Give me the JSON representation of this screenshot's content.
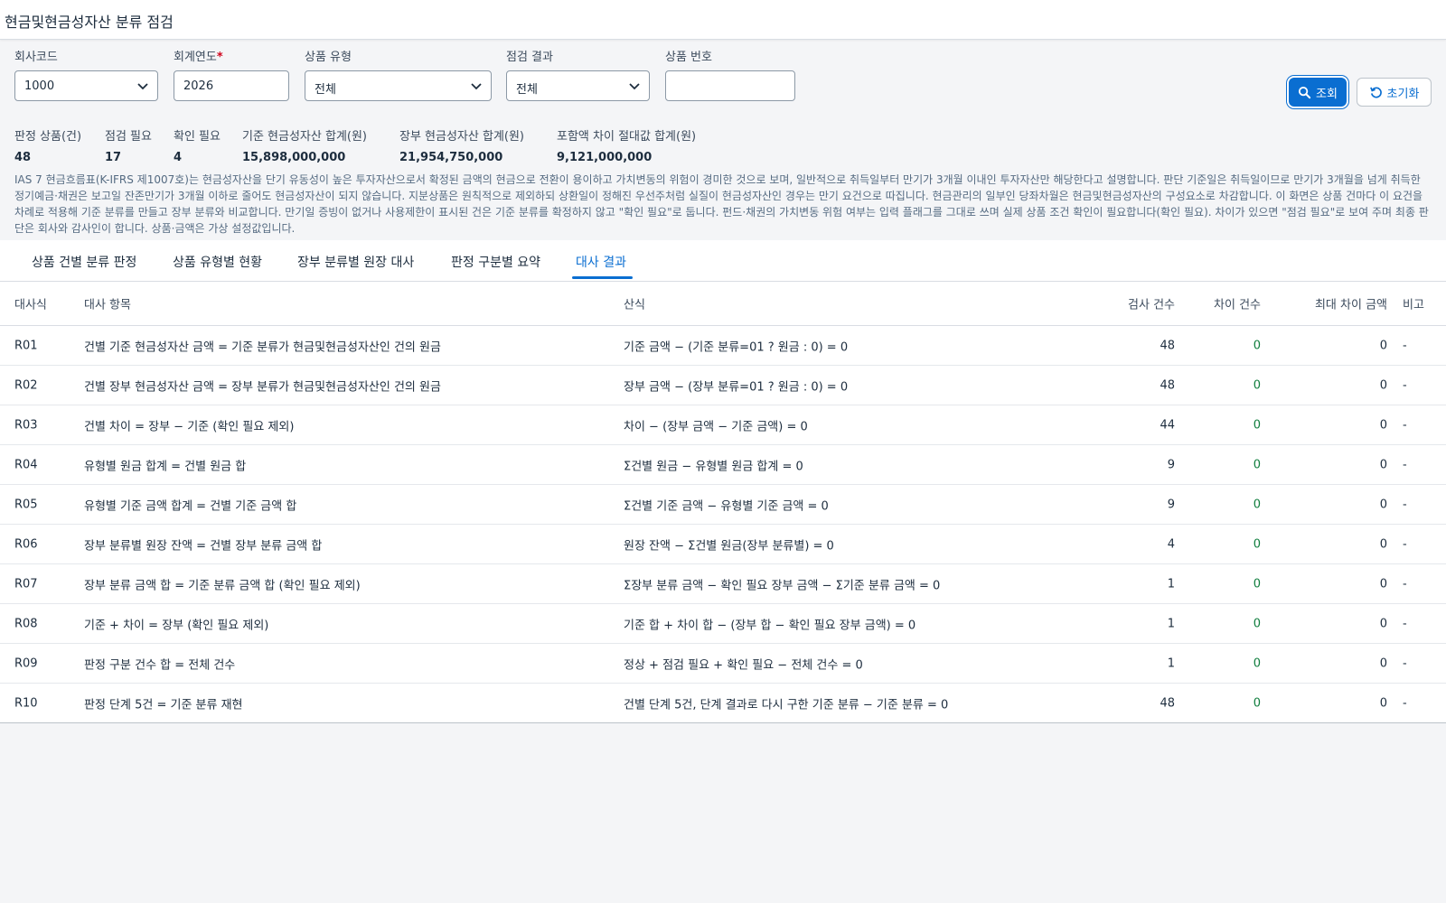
{
  "page_title": "현금및현금성자산 분류 점검",
  "filters": {
    "company_code": {
      "label": "회사코드",
      "value": "1000"
    },
    "fiscal_year": {
      "label": "회계연도",
      "required_mark": "*",
      "value": "2026"
    },
    "product_type": {
      "label": "상품 유형",
      "value": "전체"
    },
    "check_result": {
      "label": "점검 결과",
      "value": "전체"
    },
    "product_number": {
      "label": "상품 번호",
      "value": ""
    }
  },
  "buttons": {
    "search": "조회",
    "reset": "초기화"
  },
  "kpis": [
    {
      "label": "판정 상품(건)",
      "value": "48"
    },
    {
      "label": "점검 필요",
      "value": "17"
    },
    {
      "label": "확인 필요",
      "value": "4"
    },
    {
      "label": "기준 현금성자산 합계(원)",
      "value": "15,898,000,000"
    },
    {
      "label": "장부 현금성자산 합계(원)",
      "value": "21,954,750,000"
    },
    {
      "label": "포함액 차이 절대값 합계(원)",
      "value": "9,121,000,000"
    }
  ],
  "notice": "IAS 7 현금흐름표(K-IFRS 제1007호)는 현금성자산을 단기 유동성이 높은 투자자산으로서 확정된 금액의 현금으로 전환이 용이하고 가치변동의 위험이 경미한 것으로 보며, 일반적으로 취득일부터 만기가 3개월 이내인 투자자산만 해당한다고 설명합니다. 판단 기준일은 취득일이므로 만기가 3개월을 넘게 취득한 정기예금·채권은 보고일 잔존만기가 3개월 이하로 줄어도 현금성자산이 되지 않습니다. 지분상품은 원칙적으로 제외하되 상환일이 정해진 우선주처럼 실질이 현금성자산인 경우는 만기 요건으로 따집니다. 현금관리의 일부인 당좌차월은 현금및현금성자산의 구성요소로 차감합니다. 이 화면은 상품 건마다 이 요건을 차례로 적용해 기준 분류를 만들고 장부 분류와 비교합니다. 만기일 증빙이 없거나 사용제한이 표시된 건은 기준 분류를 확정하지 않고 \"확인 필요\"로 둡니다. 펀드·채권의 가치변동 위험 여부는 입력 플래그를 그대로 쓰며 실제 상품 조건 확인이 필요합니다(확인 필요). 차이가 있으면 \"점검 필요\"로 보여 주며 최종 판단은 회사와 감사인이 합니다. 상품·금액은 가상 설정값입니다.",
  "tabs": [
    {
      "label": "상품 건별 분류 판정",
      "active": false
    },
    {
      "label": "상품 유형별 현황",
      "active": false
    },
    {
      "label": "장부 분류별 원장 대사",
      "active": false
    },
    {
      "label": "판정 구분별 요약",
      "active": false
    },
    {
      "label": "대사 결과",
      "active": true
    }
  ],
  "table": {
    "headers": {
      "id": "대사식",
      "item": "대사 항목",
      "formula": "산식",
      "count": "검사 건수",
      "diff": "차이 건수",
      "max": "최대 차이 금액",
      "note": "비고"
    },
    "rows": [
      {
        "id": "R01",
        "item": "건별 기준 현금성자산 금액 = 기준 분류가 현금및현금성자산인 건의 원금",
        "formula": "기준 금액 − (기준 분류=01 ? 원금 : 0) = 0",
        "count": "48",
        "diff": "0",
        "max": "0",
        "note": "-"
      },
      {
        "id": "R02",
        "item": "건별 장부 현금성자산 금액 = 장부 분류가 현금및현금성자산인 건의 원금",
        "formula": "장부 금액 − (장부 분류=01 ? 원금 : 0) = 0",
        "count": "48",
        "diff": "0",
        "max": "0",
        "note": "-"
      },
      {
        "id": "R03",
        "item": "건별 차이 = 장부 − 기준 (확인 필요 제외)",
        "formula": "차이 − (장부 금액 − 기준 금액) = 0",
        "count": "44",
        "diff": "0",
        "max": "0",
        "note": "-"
      },
      {
        "id": "R04",
        "item": "유형별 원금 합계 = 건별 원금 합",
        "formula": "Σ건별 원금 − 유형별 원금 합계 = 0",
        "count": "9",
        "diff": "0",
        "max": "0",
        "note": "-"
      },
      {
        "id": "R05",
        "item": "유형별 기준 금액 합계 = 건별 기준 금액 합",
        "formula": "Σ건별 기준 금액 − 유형별 기준 금액 = 0",
        "count": "9",
        "diff": "0",
        "max": "0",
        "note": "-"
      },
      {
        "id": "R06",
        "item": "장부 분류별 원장 잔액 = 건별 장부 분류 금액 합",
        "formula": "원장 잔액 − Σ건별 원금(장부 분류별) = 0",
        "count": "4",
        "diff": "0",
        "max": "0",
        "note": "-"
      },
      {
        "id": "R07",
        "item": "장부 분류 금액 합 = 기준 분류 금액 합 (확인 필요 제외)",
        "formula": "Σ장부 분류 금액 − 확인 필요 장부 금액 − Σ기준 분류 금액 = 0",
        "count": "1",
        "diff": "0",
        "max": "0",
        "note": "-"
      },
      {
        "id": "R08",
        "item": "기준 + 차이 = 장부 (확인 필요 제외)",
        "formula": "기준 합 + 차이 합 − (장부 합 − 확인 필요 장부 금액) = 0",
        "count": "1",
        "diff": "0",
        "max": "0",
        "note": "-"
      },
      {
        "id": "R09",
        "item": "판정 구분 건수 합 = 전체 건수",
        "formula": "정상 + 점검 필요 + 확인 필요 − 전체 건수 = 0",
        "count": "1",
        "diff": "0",
        "max": "0",
        "note": "-"
      },
      {
        "id": "R10",
        "item": "판정 단계 5건 = 기준 분류 재현",
        "formula": "건별 단계 5건, 단계 결과로 다시 구한 기준 분류 − 기준 분류 = 0",
        "count": "48",
        "diff": "0",
        "max": "0",
        "note": "-"
      }
    ]
  }
}
